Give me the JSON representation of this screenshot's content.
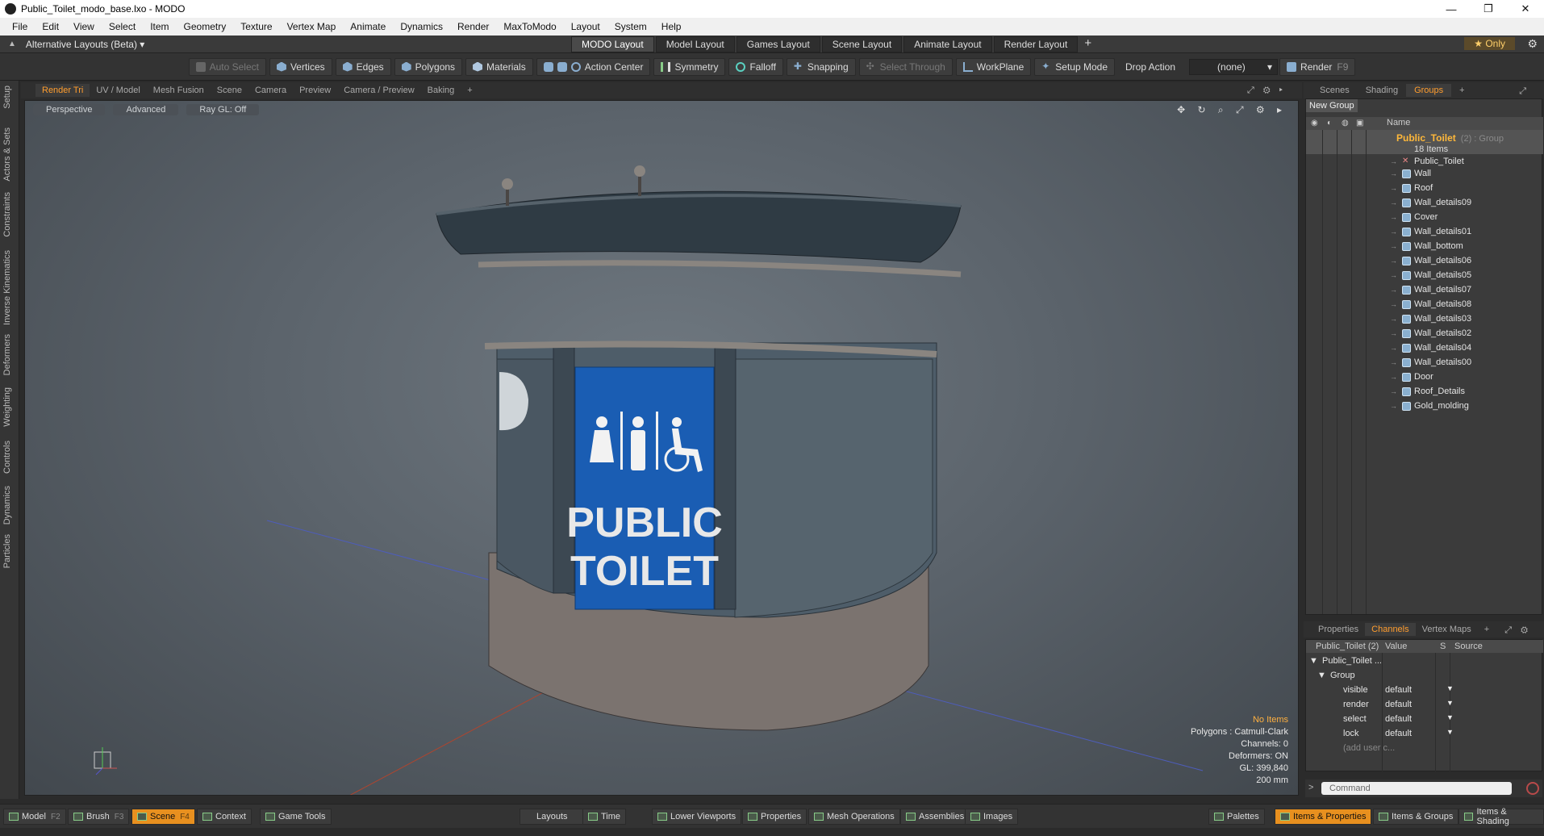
{
  "window": {
    "title": "Public_Toilet_modo_base.lxo - MODO",
    "controls": [
      "—",
      "❐",
      "✕"
    ]
  },
  "menu": [
    "File",
    "Edit",
    "View",
    "Select",
    "Item",
    "Geometry",
    "Texture",
    "Vertex Map",
    "Animate",
    "Dynamics",
    "Render",
    "MaxToModo",
    "Layout",
    "System",
    "Help"
  ],
  "layoutbar": {
    "alt_layouts": "Alternative Layouts (Beta) ▾",
    "tabs": [
      "MODO Layout",
      "Model Layout",
      "Games Layout",
      "Scene Layout",
      "Animate Layout",
      "Render Layout"
    ],
    "active_tab": "MODO Layout",
    "plus": "+",
    "only": "★  Only"
  },
  "toolbar": {
    "auto_select": "Auto Select",
    "vertices": "Vertices",
    "edges": "Edges",
    "polygons": "Polygons",
    "materials": "Materials",
    "action_center": "Action Center",
    "symmetry": "Symmetry",
    "falloff": "Falloff",
    "snapping": "Snapping",
    "select_through": "Select Through",
    "workplane": "WorkPlane",
    "setup_mode": "Setup Mode",
    "drop_action": "Drop Action",
    "drop_value": "(none)",
    "render": "Render",
    "render_key": "F9"
  },
  "left_tabs": [
    "Setup",
    "Actors & Sets",
    "Constraints",
    "Inverse Kinematics",
    "Deformers",
    "Weighting",
    "Controls",
    "Dynamics",
    "Particles"
  ],
  "viewport_tabs": [
    "Render Tri",
    "UV / Model",
    "Mesh Fusion",
    "Scene",
    "Camera",
    "Preview",
    "Camera / Preview",
    "Baking",
    "+"
  ],
  "viewport": {
    "perspective": "Perspective",
    "advanced": "Advanced",
    "raygl": "Ray GL: Off",
    "sign_line1": "PUBLIC",
    "sign_line2": "TOILET",
    "info": {
      "items": "No Items",
      "polygons": "Polygons : Catmull-Clark",
      "channels": "Channels: 0",
      "deformers": "Deformers: ON",
      "gl": "GL: 399,840",
      "scale": "200 mm"
    }
  },
  "right_tabs": [
    "Scenes",
    "Shading",
    "Groups",
    "+"
  ],
  "groups": {
    "new_group": "New Group",
    "name_header": "Name",
    "group_name": "Public_Toilet",
    "group_sub": "(2) : Group",
    "count": "18 Items",
    "items": [
      "Public_Toilet",
      "Wall",
      "Roof",
      "Wall_details09",
      "Cover",
      "Wall_details01",
      "Wall_bottom",
      "Wall_details06",
      "Wall_details05",
      "Wall_details07",
      "Wall_details08",
      "Wall_details03",
      "Wall_details02",
      "Wall_details04",
      "Wall_details00",
      "Door",
      "Roof_Details",
      "Gold_molding"
    ]
  },
  "channel_tabs": [
    "Properties",
    "Channels",
    "Vertex Maps",
    "+"
  ],
  "channels": {
    "header_item": "Public_Toilet (2)",
    "header_value": "Value",
    "header_s": "S",
    "header_source": "Source",
    "root": "Public_Toilet ...",
    "group": "Group",
    "rows": [
      {
        "name": "visible",
        "value": "default"
      },
      {
        "name": "render",
        "value": "default"
      },
      {
        "name": "select",
        "value": "default"
      },
      {
        "name": "lock",
        "value": "default"
      }
    ],
    "add_user": "(add user c..."
  },
  "command": {
    "prompt": ">",
    "placeholder": "Command"
  },
  "bottom": {
    "model": "Model",
    "model_key": "F2",
    "brush": "Brush",
    "brush_key": "F3",
    "scene": "Scene",
    "scene_key": "F4",
    "context": "Context",
    "game_tools": "Game Tools",
    "layouts": "Layouts",
    "time": "Time",
    "lower_viewports": "Lower Viewports",
    "properties": "Properties",
    "mesh_operations": "Mesh Operations",
    "assemblies": "Assemblies",
    "images": "Images",
    "palettes": "Palettes",
    "items_properties": "Items & Properties",
    "items_groups": "Items & Groups",
    "items_shading": "Items & Shading"
  },
  "colors": {
    "accent": "#ff9d2e",
    "sign_blue": "#1a5db3",
    "group_name": "#ffb83a"
  }
}
